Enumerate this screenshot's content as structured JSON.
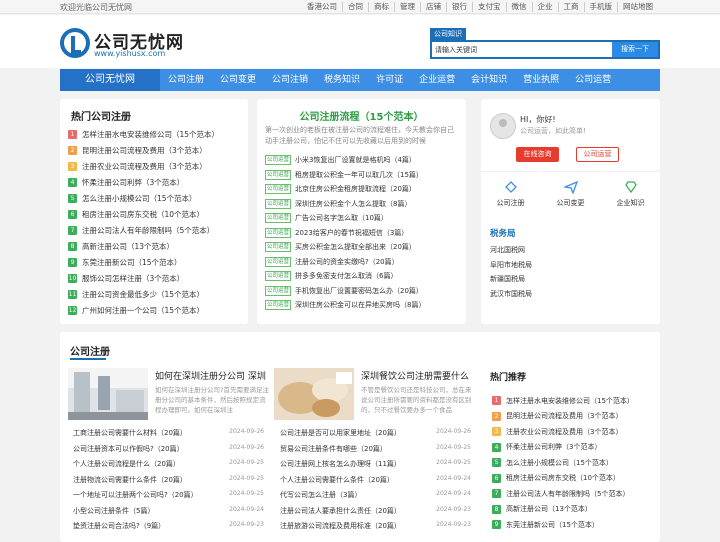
{
  "topbar": {
    "welcome": "欢迎光临公司无忧网",
    "links": [
      "香港公司",
      "合同",
      "商标",
      "管理",
      "店铺",
      "银行",
      "支付宝",
      "微信",
      "企业",
      "工商",
      "手机版",
      "网站地图"
    ]
  },
  "logo": {
    "title": "公司无忧网",
    "url": "www.yishusx.com"
  },
  "search": {
    "tag": "公司知识",
    "placeholder": "请输入关键词",
    "button": "搜索一下"
  },
  "nav": {
    "brand": "公司无忧网",
    "items": [
      "公司注册",
      "公司变更",
      "公司注销",
      "税务知识",
      "许可证",
      "企业运营",
      "会计知识",
      "营业执照",
      "公司运营"
    ]
  },
  "hot": {
    "title": "热门公司注册",
    "items": [
      {
        "n": "1",
        "t": "怎样注册水电安装维修公司（15个范本）"
      },
      {
        "n": "2",
        "t": "昆明注册公司流程及费用（3个范本）"
      },
      {
        "n": "3",
        "t": "注册农业公司流程及费用（3个范本）"
      },
      {
        "n": "4",
        "t": "怀柔注册公司利弊（3个范本）"
      },
      {
        "n": "5",
        "t": "怎么注册小规模公司（15个范本）"
      },
      {
        "n": "6",
        "t": "租房注册公司房东交税（10个范本）"
      },
      {
        "n": "7",
        "t": "注册公司法人有年龄限制吗（5个范本）"
      },
      {
        "n": "8",
        "t": "高新注册公司（13个范本）"
      },
      {
        "n": "9",
        "t": "东莞注册新公司（15个范本）"
      },
      {
        "n": "10",
        "t": "服饰公司怎样注册（3个范本）"
      },
      {
        "n": "11",
        "t": "注册公司资金最低多少（15个范本）"
      },
      {
        "n": "12",
        "t": "广州如何注册一个公司（15个范本）"
      }
    ]
  },
  "process": {
    "title": "公司注册流程（15个范本）",
    "intro": "第一次创业的老板在被注册公司的流程难住，今天教会你自己动手注册公司，怕记不住可以先收藏以后用到的时候",
    "tag": "公司运营",
    "items": [
      "小米3恢复出厂设置就是格机吗（4篇）",
      "租房提取公积金一年可以取几次（15篇）",
      "北京住房公积金租房提取流程（20篇）",
      "深圳住房公积金个人怎么提取（8篇）",
      "广告公司名字怎么取（10篇）",
      "2023给客户的春节祝福短信（3篇）",
      "买房公积金怎么提取全部出来（20篇）",
      "注册公司的资金实缴吗?（20篇）",
      "拼多多免密支付怎么取消（6篇）",
      "手机恢复出厂设置要密码怎么办（20篇）",
      "深圳住房公积金可以在异地买房吗（8篇）"
    ]
  },
  "user": {
    "hello": "HI，你好!",
    "sub": "公司运营，如此简单!",
    "btn1": "在线咨询",
    "btn2": "公司运营"
  },
  "services": [
    "公司注册",
    "公司变更",
    "企业知识"
  ],
  "tax": {
    "title": "税务局",
    "items": [
      "河北国税网",
      "阜阳市地税局",
      "新疆国税局",
      "武汉市国税局"
    ]
  },
  "reg": {
    "title": "公司注册",
    "feat1": {
      "title": "如何在深圳注册分公司 深圳",
      "desc": "如何在深圳注册分公司?首先需要满足注册分公司的基本条件，然后按照规定流程办理即可。如何在深圳注"
    },
    "feat2": {
      "title": "深圳餐饮公司注册需要什么",
      "desc": "不管是餐饮公司还是科技公司，总在来说公司注册所需要的资料都是没有区别的，只不过餐饮要办多一个食品"
    },
    "left": [
      {
        "t": "工商注册公司需要什么材料（20篇）",
        "d": "2024-09-26"
      },
      {
        "t": "公司注册资本可以作假吗?（20篇）",
        "d": "2024-09-26"
      },
      {
        "t": "个人注册公司流程是什么（20篇）",
        "d": "2024-09-25"
      },
      {
        "t": "注册物流公司需要什么条件（20篇）",
        "d": "2024-09-25"
      },
      {
        "t": "一个地址可以注册两个公司吗?（20篇）",
        "d": "2024-09-25"
      },
      {
        "t": "小型公司注册条件（5篇）",
        "d": "2024-09-24"
      },
      {
        "t": "垫资注册公司合法吗?（9篇）",
        "d": "2024-09-23"
      }
    ],
    "right": [
      {
        "t": "公司注册是否可以用家里地址（20篇）",
        "d": "2024-09-26"
      },
      {
        "t": "贸易公司注册条件有哪些（20篇）",
        "d": "2024-09-25"
      },
      {
        "t": "公司注册网上核名怎么办理呀（11篇）",
        "d": "2024-09-25"
      },
      {
        "t": "个人注册公司需要什么条件（20篇）",
        "d": "2024-09-24"
      },
      {
        "t": "代写公司怎么注册（3篇）",
        "d": "2024-09-24"
      },
      {
        "t": "注册公司法人要承担什么责任（20篇）",
        "d": "2024-09-23"
      },
      {
        "t": "注册旅游公司流程及费用标准（20篇）",
        "d": "2024-09-23"
      }
    ]
  },
  "side": {
    "title": "热门推荐",
    "items": [
      {
        "n": "1",
        "t": "怎样注册水电安装维修公司（15个范本）"
      },
      {
        "n": "2",
        "t": "昆明注册公司流程及费用（3个范本）"
      },
      {
        "n": "3",
        "t": "注册农业公司流程及费用（3个范本）"
      },
      {
        "n": "4",
        "t": "怀柔注册公司利弊（3个范本）"
      },
      {
        "n": "5",
        "t": "怎么注册小规模公司（15个范本）"
      },
      {
        "n": "6",
        "t": "租房注册公司房东交税（10个范本）"
      },
      {
        "n": "7",
        "t": "注册公司法人有年龄限制吗（5个范本）"
      },
      {
        "n": "8",
        "t": "高新注册公司（13个范本）"
      },
      {
        "n": "9",
        "t": "东莞注册新公司（15个范本）"
      }
    ]
  },
  "colors": {
    "primary": "#1a6fb6",
    "nav": "#3d8fe6",
    "green": "#2e9b45",
    "red": "#e53c2e",
    "num": [
      "#e86a6a",
      "#f0a04a",
      "#f2b84b",
      "#3cae5a",
      "#3cae5a",
      "#3cae5a",
      "#3cae5a",
      "#3cae5a",
      "#3cae5a",
      "#3cae5a",
      "#3cae5a",
      "#3cae5a"
    ]
  }
}
